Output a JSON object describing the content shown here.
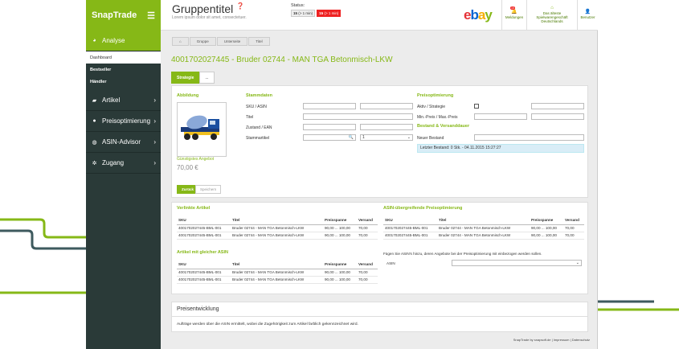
{
  "brand": {
    "name": "SnapTrade",
    "menu_icon": "hamburger-icon",
    "accent": "#86b817",
    "sidebar_bg": "#2a3a38"
  },
  "sidebar": {
    "items": [
      {
        "label": "Analyse",
        "icon": "dashboard-icon",
        "active": true
      },
      {
        "label": "Artikel",
        "icon": "tag-icon"
      },
      {
        "label": "Preisoptimierung",
        "icon": "coins-icon"
      },
      {
        "label": "ASIN-Advisor",
        "icon": "globe-icon"
      },
      {
        "label": "Zugang",
        "icon": "gear-icon"
      }
    ],
    "sub": [
      {
        "label": "Dashboard",
        "selected": true
      },
      {
        "label": "Bestseller"
      },
      {
        "label": "Händler"
      }
    ]
  },
  "header": {
    "title": "Gruppentitel",
    "subtitle": "Lorem ipsum dolor sit amet, consectetuer.",
    "status_label": "Status:",
    "status_badges": [
      {
        "count": "15",
        "text": "(> 1 min)"
      },
      {
        "count": "15",
        "text": "(> 1 min)"
      }
    ],
    "marketplace_logo": "ebay",
    "buttons": [
      {
        "label": "Meldungen",
        "icon": "bell-icon",
        "count": "10"
      },
      {
        "label": "Das älteste Spielwarengeschäft Deutschlands",
        "icon": "home-icon"
      },
      {
        "label": "Benutzer",
        "icon": "user-icon"
      }
    ]
  },
  "breadcrumb": [
    "Gruppe",
    "Unterseite",
    "Titel"
  ],
  "page_title": "4001702027445 - Bruder 02744 - MAN TGA Betonmisch-LKW",
  "tabs": [
    "Strategie",
    "..."
  ],
  "form": {
    "abbildung_title": "Abbildung",
    "price_label": "Günstigstes Angebot",
    "price": "70,00 €",
    "stammdaten_title": "Stammdaten",
    "fields": [
      "SKU / ASIN",
      "Titel",
      "Zustand / EAN",
      "Stammartikel"
    ],
    "stammartikel_qty": "1",
    "preis_title": "Preisoptimierung",
    "preis_fields": [
      "Aktiv / Strategie",
      "Min.-Preis / Max.-Preis"
    ],
    "bestand_title": "Bestand & Versanddauer",
    "neuer_bestand": "Neuer Bestand",
    "letzter_bestand": "Letzter Bestand: 0 Stk. - 04.11.2015 15:27:27",
    "btn_back": "Zurück",
    "btn_save": "Speichern"
  },
  "linked": {
    "title": "Verlinkte Artikel",
    "headers": [
      "SKU",
      "Titel",
      "Preisspanne",
      "Versand"
    ],
    "rows": [
      [
        "4001702027445-BML-001",
        "Bruder 02744 - MAN TGA Betonmisch-LKW",
        "90,00 ... 100,00",
        "70,00"
      ],
      [
        "4001702027445-BML-001",
        "Bruder 02744 - MAN TGA Betonmisch-LKW",
        "90,00 ... 100,00",
        "70,00"
      ]
    ]
  },
  "same_asin": {
    "title": "Artikel mit gleicher ASIN",
    "headers": [
      "SKU",
      "Titel",
      "Preisspanne",
      "Versand"
    ],
    "rows": [
      [
        "4001702027445-BML-001",
        "Bruder 02744 - MAN TGA Betonmisch-LKW",
        "90,00 ... 100,00",
        "70,00"
      ],
      [
        "4001702027445-BML-001",
        "Bruder 02744 - MAN TGA Betonmisch-LKW",
        "90,00 ... 100,00",
        "70,00"
      ]
    ]
  },
  "asin_opt": {
    "title": "ASIN-übergreifende Preisoptimierung",
    "headers": [
      "SKU",
      "Titel",
      "Preisspanne",
      "Versand"
    ],
    "rows": [
      [
        "4001702027445-BML-001",
        "Bruder 02744 - MAN TGA Betonmisch-LKW",
        "90,00 ... 100,00",
        "70,00"
      ],
      [
        "4001702027445-BML-001",
        "Bruder 02744 - MAN TGA Betonmisch-LKW",
        "90,00 ... 100,00",
        "70,00"
      ]
    ],
    "hint": "Fügen Sie ASIN's hinzu, deren Angebote bei der Preisoptimierung mit einbezogen werden sollen.",
    "asin_label": "ASIN"
  },
  "preisentwicklung": {
    "title": "Preisentwicklung",
    "text": "Aufträge werden über die ASIN ermittelt, wobei die Zugehörigkeit zum Artikel farblich gekennzeichnet wird."
  },
  "footer": "SnapTrade by snapsoft.de | Impressum | Datenschutz"
}
